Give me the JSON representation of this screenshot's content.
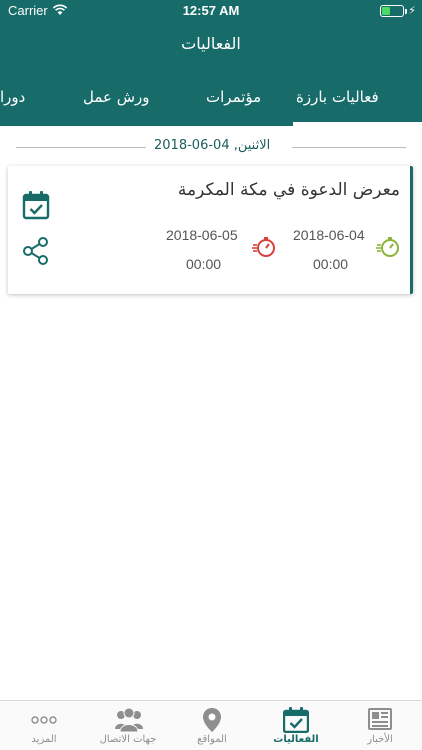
{
  "status_bar": {
    "carrier": "Carrier",
    "time": "12:57 AM"
  },
  "header": {
    "title": "الفعاليات"
  },
  "tabs": [
    {
      "label": "فعاليات بارزة"
    },
    {
      "label": "مؤتمرات"
    },
    {
      "label": "ورش عمل"
    },
    {
      "label": "دورا"
    }
  ],
  "date_separator": "الاثنين, 04-06-2018",
  "event": {
    "title": "معرض الدعوة في مكة المكرمة",
    "start_date": "2018-06-04",
    "start_time": "00:00",
    "end_date": "2018-06-05",
    "end_time": "00:00"
  },
  "bottom_nav": [
    {
      "label": "الأخبار",
      "icon": "news-icon"
    },
    {
      "label": "الفعاليات",
      "icon": "calendar-icon"
    },
    {
      "label": "المواقع",
      "icon": "location-pin-icon"
    },
    {
      "label": "جهات الاتصال",
      "icon": "contacts-icon"
    },
    {
      "label": "المزيد",
      "icon": "more-icon"
    }
  ],
  "colors": {
    "primary": "#176b69",
    "start": "#8bb53a",
    "end": "#d9403a"
  }
}
